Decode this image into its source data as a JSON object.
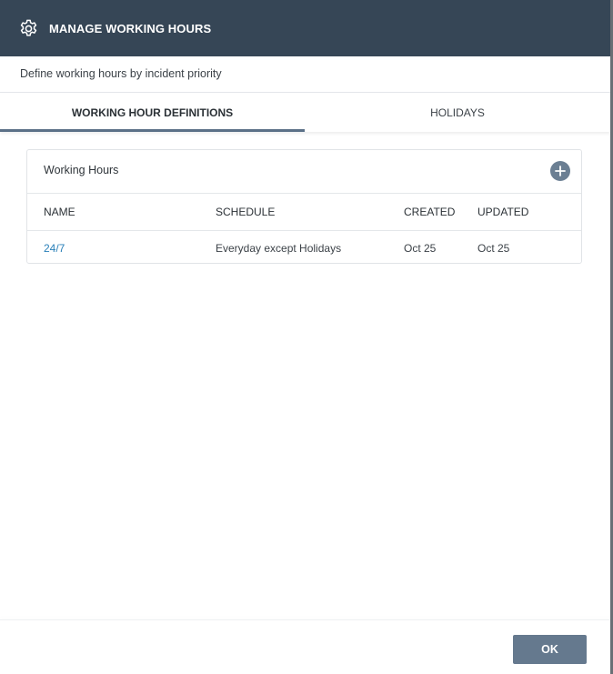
{
  "dialog": {
    "title": "MANAGE WORKING HOURS",
    "subtitle": "Define working hours by incident priority",
    "header_color": "#364656",
    "accent_color": "#5b7087",
    "link_color": "#2a80b9"
  },
  "tabs": [
    {
      "label": "WORKING HOUR DEFINITIONS",
      "active": true
    },
    {
      "label": "HOLIDAYS",
      "active": false
    }
  ],
  "working_hours": {
    "title": "Working Hours",
    "add_icon": "plus-icon",
    "columns": [
      "NAME",
      "SCHEDULE",
      "CREATED",
      "UPDATED"
    ],
    "rows": [
      {
        "name": "24/7",
        "schedule": "Everyday except Holidays",
        "created": "Oct 25",
        "updated": "Oct 25"
      }
    ]
  },
  "footer": {
    "ok_label": "OK"
  }
}
